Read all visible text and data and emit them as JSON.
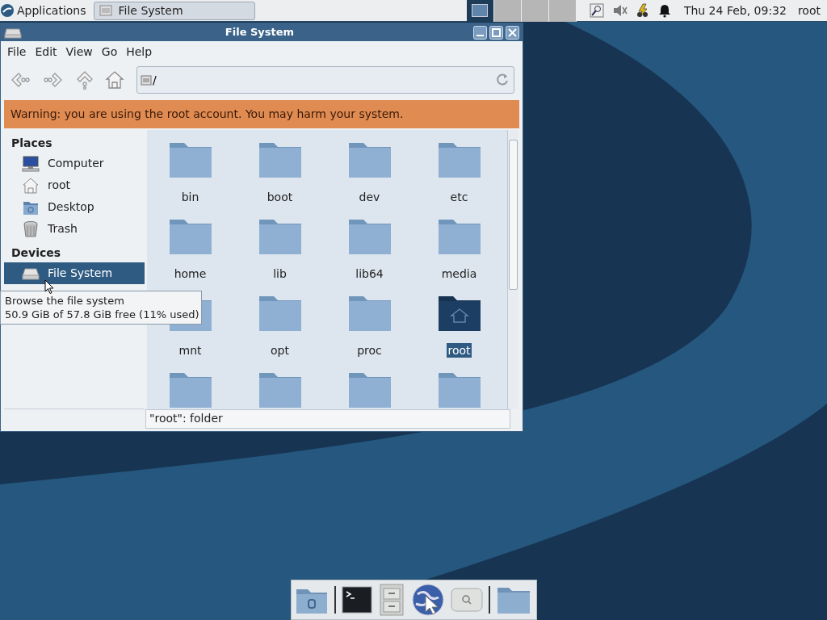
{
  "panel": {
    "applications": "Applications",
    "tasks": [
      {
        "label": "File System",
        "selected": true
      }
    ],
    "workspaces": [
      {
        "selected": true
      },
      {
        "selected": false
      },
      {
        "selected": false
      },
      {
        "selected": false
      }
    ],
    "clock": "Thu 24 Feb, 09:32",
    "user": "root"
  },
  "window": {
    "title": "File System",
    "menu": [
      "File",
      "Edit",
      "View",
      "Go",
      "Help"
    ],
    "location": "/",
    "warning": "Warning: you are using the root account. You may harm your system.",
    "sidebar": [
      {
        "heading": "Places",
        "items": [
          {
            "kind": "computer",
            "label": "Computer",
            "selected": false
          },
          {
            "kind": "home",
            "label": "root",
            "selected": false
          },
          {
            "kind": "desktop",
            "label": "Desktop",
            "selected": false
          },
          {
            "kind": "trash",
            "label": "Trash",
            "selected": false
          }
        ]
      },
      {
        "heading": "Devices",
        "items": [
          {
            "kind": "drive",
            "label": "File System",
            "selected": true
          }
        ]
      }
    ],
    "folders": [
      {
        "label": "bin",
        "selected": false
      },
      {
        "label": "boot",
        "selected": false
      },
      {
        "label": "dev",
        "selected": false
      },
      {
        "label": "etc",
        "selected": false
      },
      {
        "label": "home",
        "selected": false
      },
      {
        "label": "lib",
        "selected": false
      },
      {
        "label": "lib64",
        "selected": false
      },
      {
        "label": "media",
        "selected": false
      },
      {
        "label": "mnt",
        "selected": false
      },
      {
        "label": "opt",
        "selected": false
      },
      {
        "label": "proc",
        "selected": false
      },
      {
        "label": "root",
        "selected": true,
        "kind": "home"
      },
      {
        "selected": false
      },
      {
        "selected": false
      },
      {
        "selected": false
      },
      {
        "selected": false
      }
    ],
    "status": "\"root\": folder"
  },
  "tooltip": [
    "Browse the file system",
    "50.9 GiB of 57.8 GiB free (11% used)"
  ]
}
